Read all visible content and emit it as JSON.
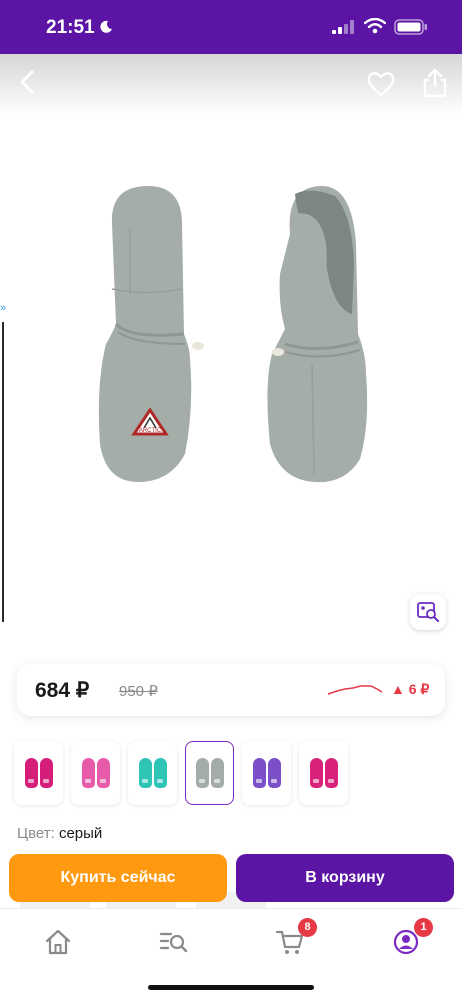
{
  "status_bar": {
    "time": "21:51"
  },
  "product": {
    "price": "684 ₽",
    "old_price": "950 ₽",
    "price_change": "6 ₽",
    "color_label": "Цвет:",
    "color_value": "серый",
    "image_badge": "ARCTIC"
  },
  "variants": [
    {
      "color": "#d41e7a",
      "selected": false
    },
    {
      "color": "#e85aaa",
      "selected": false
    },
    {
      "color": "#2ec4b6",
      "selected": false
    },
    {
      "color": "#a3aca6",
      "selected": true
    },
    {
      "color": "#7a4fc8",
      "selected": false
    },
    {
      "color": "#d9237a",
      "selected": false
    }
  ],
  "actions": {
    "buy_now": "Купить сейчас",
    "add_to_cart": "В корзину"
  },
  "bottom_nav": {
    "cart_badge": "8",
    "profile_badge": "1"
  },
  "colors": {
    "brand_purple": "#5b14a3",
    "buy_orange": "#ff9910",
    "alert_red": "#e63946"
  }
}
